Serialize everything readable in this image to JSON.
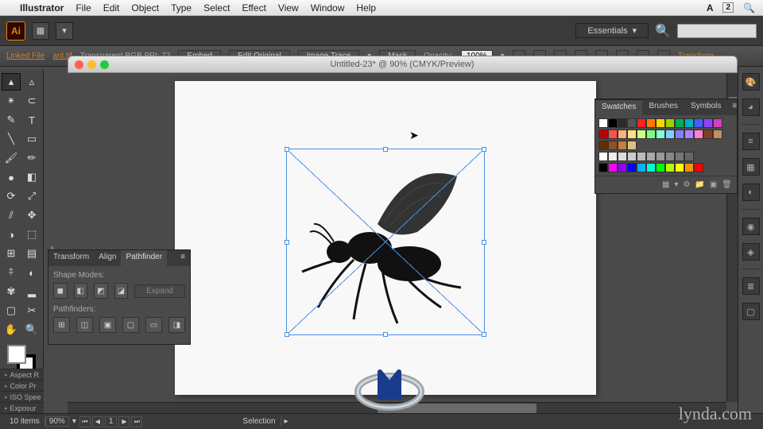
{
  "mac_menu": {
    "app": "Illustrator",
    "items": [
      "File",
      "Edit",
      "Object",
      "Type",
      "Select",
      "Effect",
      "View",
      "Window",
      "Help"
    ],
    "right_badge": "2"
  },
  "chrome": {
    "workspace": "Essentials"
  },
  "control_bar": {
    "label": "Linked File",
    "file_link": "ant.tif",
    "color_info": "Transparent RGB   PPI: 72",
    "buttons": {
      "embed": "Embed",
      "edit_original": "Edit Original",
      "image_trace": "Image Trace",
      "mask": "Mask"
    },
    "opacity_label": "Opacity:",
    "opacity_value": "100%",
    "transform": "Transform"
  },
  "document": {
    "title": "Untitled-23* @ 90% (CMYK/Preview)"
  },
  "swatches_panel": {
    "tabs": [
      "Swatches",
      "Brushes",
      "Symbols"
    ],
    "colors_row1": [
      "#ffffff",
      "#000000",
      "#2b2b2b",
      "#555555",
      "#ff2020",
      "#ff7a00",
      "#ffd400",
      "#a0d000",
      "#00b050",
      "#00b0c0",
      "#4060ff",
      "#9040ff",
      "#d040c0"
    ],
    "colors_row2": [
      "#c00000",
      "#ff5050",
      "#ffb080",
      "#ffe080",
      "#d0ff80",
      "#80ff80",
      "#80ffd0",
      "#80d0ff",
      "#8080ff",
      "#b080ff",
      "#ff80d0",
      "#804020",
      "#c09060"
    ],
    "colors_row3": [
      "#603000",
      "#905020",
      "#c08040",
      "#e0c080"
    ],
    "grays": [
      "#ffffff",
      "#eeeeee",
      "#dddddd",
      "#cccccc",
      "#bbbbbb",
      "#aaaaaa",
      "#999999",
      "#888888",
      "#777777",
      "#666666"
    ],
    "brights": [
      "#000000",
      "#ff00ff",
      "#9000ff",
      "#0000ff",
      "#00b0ff",
      "#00ffd0",
      "#00ff00",
      "#b0ff00",
      "#ffff00",
      "#ff9000",
      "#ff0000"
    ]
  },
  "pathfinder": {
    "tabs": [
      "Transform",
      "Align",
      "Pathfinder"
    ],
    "shape_modes": "Shape Modes:",
    "expand": "Expand",
    "pathfinders": "Pathfinders:"
  },
  "collapsed": [
    "Aspect R",
    "Color Pr",
    "ISO Spee",
    "Exposur"
  ],
  "status": {
    "items_count": "10 items",
    "zoom": "90%",
    "page": "1",
    "tool": "Selection"
  },
  "watermark": "lynda.com"
}
